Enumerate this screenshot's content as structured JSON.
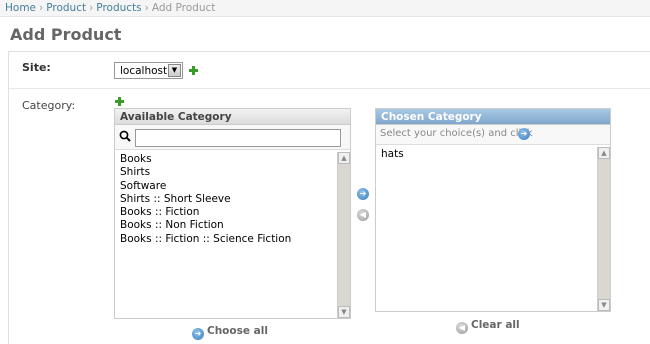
{
  "breadcrumbs": [
    "Home",
    "Product",
    "Products",
    "Add Product"
  ],
  "page_title": "Add Product",
  "site": {
    "label": "Site:",
    "selected": "localhost"
  },
  "category": {
    "label": "Category:",
    "available_header": "Available Category",
    "available_options": [
      "Books",
      "Shirts",
      "Software",
      "Shirts :: Short Sleeve",
      "Books :: Fiction",
      "Books :: Non Fiction",
      "Books :: Fiction :: Science Fiction"
    ],
    "chosen_header": "Chosen Category",
    "chosen_help": "Select your choice(s) and click",
    "chosen_options": [
      "hats"
    ],
    "choose_all_label": "Choose all",
    "clear_all_label": "Clear all"
  },
  "colors": {
    "link": "#447e9b",
    "chosen_header": "#7fa7cc",
    "add_icon": "#3a9a2a"
  },
  "icons": {
    "add": "plus-icon",
    "search": "search-icon",
    "add_arrow": "arrow-right-icon",
    "remove_arrow": "arrow-left-icon"
  }
}
